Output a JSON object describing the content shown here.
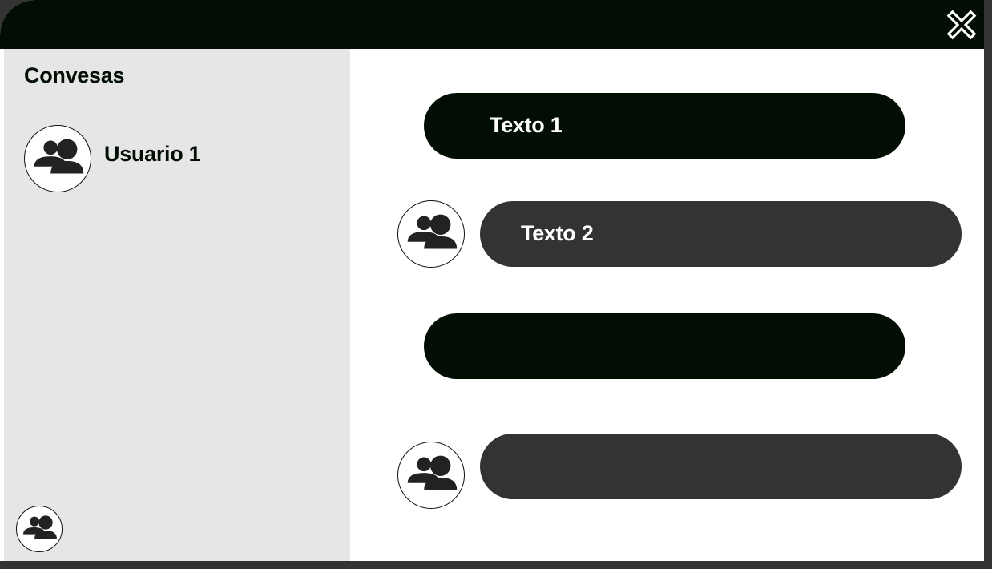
{
  "window": {
    "close_icon": "close-x-icon"
  },
  "sidebar": {
    "title": "Convesas",
    "conversations": [
      {
        "name": "Usuario 1",
        "avatar_icon": "users-icon"
      }
    ],
    "current_user_avatar_icon": "users-icon"
  },
  "chat": {
    "messages": [
      {
        "direction": "sent",
        "text": "Texto 1"
      },
      {
        "direction": "received",
        "text": "Texto 2",
        "avatar_icon": "users-icon"
      },
      {
        "direction": "sent",
        "text": ""
      },
      {
        "direction": "received",
        "text": "",
        "avatar_icon": "users-icon"
      }
    ]
  },
  "colors": {
    "titlebar": "#020e03",
    "sent_bubble": "#020e03",
    "received_bubble": "#333333",
    "sidebar_bg": "#e6e6e6",
    "frame": "#333333"
  }
}
